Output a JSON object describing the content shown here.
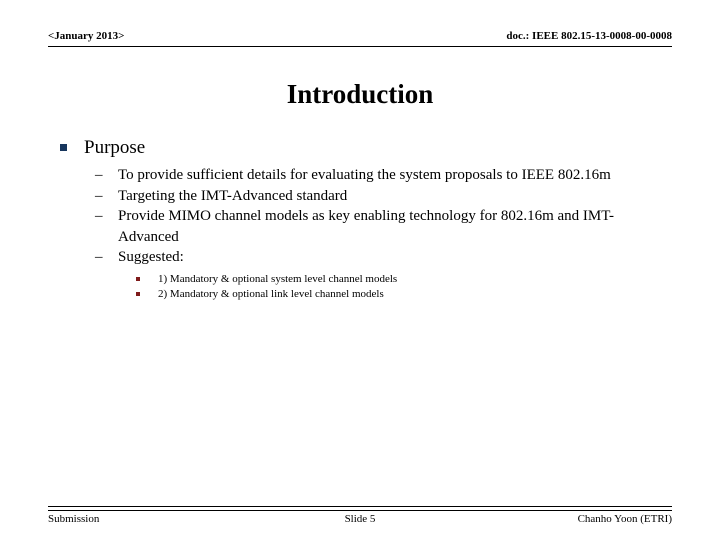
{
  "header": {
    "date_label": "<January 2013>",
    "doc_label": "doc.: IEEE 802.15-13-0008-00-0008"
  },
  "title": "Introduction",
  "body": {
    "section": {
      "label": "Purpose",
      "bullet_color": "#17365D",
      "items": [
        "To provide sufficient details for evaluating the system proposals to IEEE 802.16m",
        "Targeting the IMT-Advanced standard",
        "Provide MIMO channel models as key enabling technology for 802.16m and IMT-Advanced",
        "Suggested:"
      ],
      "sub_items": [
        "1) Mandatory & optional system level channel models",
        "2) Mandatory & optional link level channel models"
      ],
      "sub_bullet_color": "#7F1B1B"
    }
  },
  "footer": {
    "left": "Submission",
    "center": "Slide 5",
    "right": "Chanho Yoon (ETRI)"
  }
}
